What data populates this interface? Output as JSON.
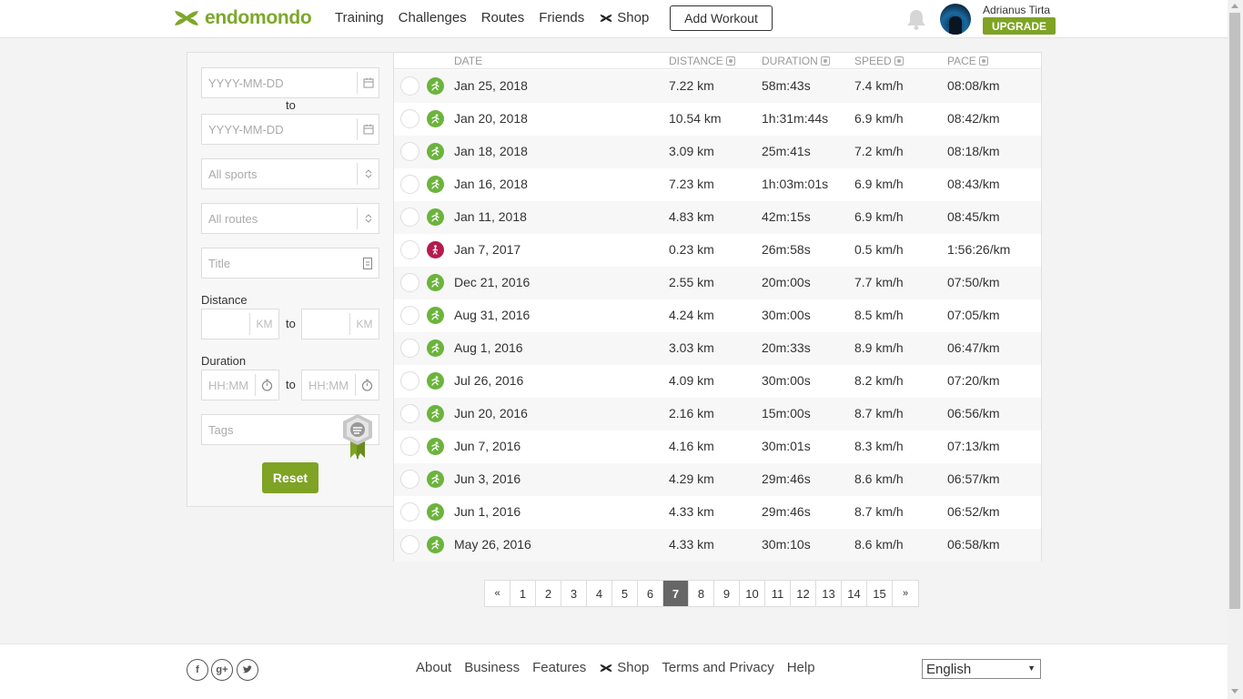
{
  "header": {
    "logo_text": "endomondo",
    "nav": [
      "Training",
      "Challenges",
      "Routes",
      "Friends"
    ],
    "shop_label": "Shop",
    "add_workout_label": "Add Workout",
    "user_name": "Adrianus Tirta",
    "upgrade_label": "UPGRADE"
  },
  "filters": {
    "start_date_placeholder": "YYYY-MM-DD",
    "to_label": "to",
    "end_date_placeholder": "YYYY-MM-DD",
    "sports_label": "All sports",
    "routes_label": "All routes",
    "title_placeholder": "Title",
    "distance_label": "Distance",
    "km_unit": "KM",
    "duration_label": "Duration",
    "duration_placeholder": "HH:MM",
    "tags_placeholder": "Tags",
    "reset_label": "Reset"
  },
  "table": {
    "columns": [
      "DATE",
      "DISTANCE",
      "DURATION",
      "SPEED",
      "PACE"
    ],
    "rows": [
      {
        "sport": "running",
        "date": "Jan 25, 2018",
        "distance": "7.22 km",
        "duration": "58m:43s",
        "speed": "7.4 km/h",
        "pace": "08:08/km"
      },
      {
        "sport": "running",
        "date": "Jan 20, 2018",
        "distance": "10.54 km",
        "duration": "1h:31m:44s",
        "speed": "6.9 km/h",
        "pace": "08:42/km"
      },
      {
        "sport": "running",
        "date": "Jan 18, 2018",
        "distance": "3.09 km",
        "duration": "25m:41s",
        "speed": "7.2 km/h",
        "pace": "08:18/km"
      },
      {
        "sport": "running",
        "date": "Jan 16, 2018",
        "distance": "7.23 km",
        "duration": "1h:03m:01s",
        "speed": "6.9 km/h",
        "pace": "08:43/km"
      },
      {
        "sport": "running",
        "date": "Jan 11, 2018",
        "distance": "4.83 km",
        "duration": "42m:15s",
        "speed": "6.9 km/h",
        "pace": "08:45/km"
      },
      {
        "sport": "walking",
        "date": "Jan 7, 2017",
        "distance": "0.23 km",
        "duration": "26m:58s",
        "speed": "0.5 km/h",
        "pace": "1:56:26/km"
      },
      {
        "sport": "running",
        "date": "Dec 21, 2016",
        "distance": "2.55 km",
        "duration": "20m:00s",
        "speed": "7.7 km/h",
        "pace": "07:50/km"
      },
      {
        "sport": "running",
        "date": "Aug 31, 2016",
        "distance": "4.24 km",
        "duration": "30m:00s",
        "speed": "8.5 km/h",
        "pace": "07:05/km"
      },
      {
        "sport": "running",
        "date": "Aug 1, 2016",
        "distance": "3.03 km",
        "duration": "20m:33s",
        "speed": "8.9 km/h",
        "pace": "06:47/km"
      },
      {
        "sport": "running",
        "date": "Jul 26, 2016",
        "distance": "4.09 km",
        "duration": "30m:00s",
        "speed": "8.2 km/h",
        "pace": "07:20/km"
      },
      {
        "sport": "running",
        "date": "Jun 20, 2016",
        "distance": "2.16 km",
        "duration": "15m:00s",
        "speed": "8.7 km/h",
        "pace": "06:56/km"
      },
      {
        "sport": "running",
        "date": "Jun 7, 2016",
        "distance": "4.16 km",
        "duration": "30m:01s",
        "speed": "8.3 km/h",
        "pace": "07:13/km"
      },
      {
        "sport": "running",
        "date": "Jun 3, 2016",
        "distance": "4.29 km",
        "duration": "29m:46s",
        "speed": "8.6 km/h",
        "pace": "06:57/km"
      },
      {
        "sport": "running",
        "date": "Jun 1, 2016",
        "distance": "4.33 km",
        "duration": "29m:46s",
        "speed": "8.7 km/h",
        "pace": "06:52/km"
      },
      {
        "sport": "running",
        "date": "May 26, 2016",
        "distance": "4.33 km",
        "duration": "30m:10s",
        "speed": "8.6 km/h",
        "pace": "06:58/km"
      }
    ]
  },
  "pagination": {
    "prev": "«",
    "pages": [
      "1",
      "2",
      "3",
      "4",
      "5",
      "6",
      "7",
      "8",
      "9",
      "10",
      "11",
      "12",
      "13",
      "14",
      "15"
    ],
    "current": "7",
    "next": "»"
  },
  "footer": {
    "social": [
      "facebook-icon",
      "google-plus-icon",
      "twitter-icon"
    ],
    "links": [
      "About",
      "Business",
      "Features"
    ],
    "shop_label": "Shop",
    "links2": [
      "Terms and Privacy",
      "Help"
    ],
    "language": "English"
  },
  "colors": {
    "brand_green": "#7da82a",
    "running_icon": "#6bb43c",
    "walking_icon": "#b51b4d",
    "active_page": "#666666"
  }
}
